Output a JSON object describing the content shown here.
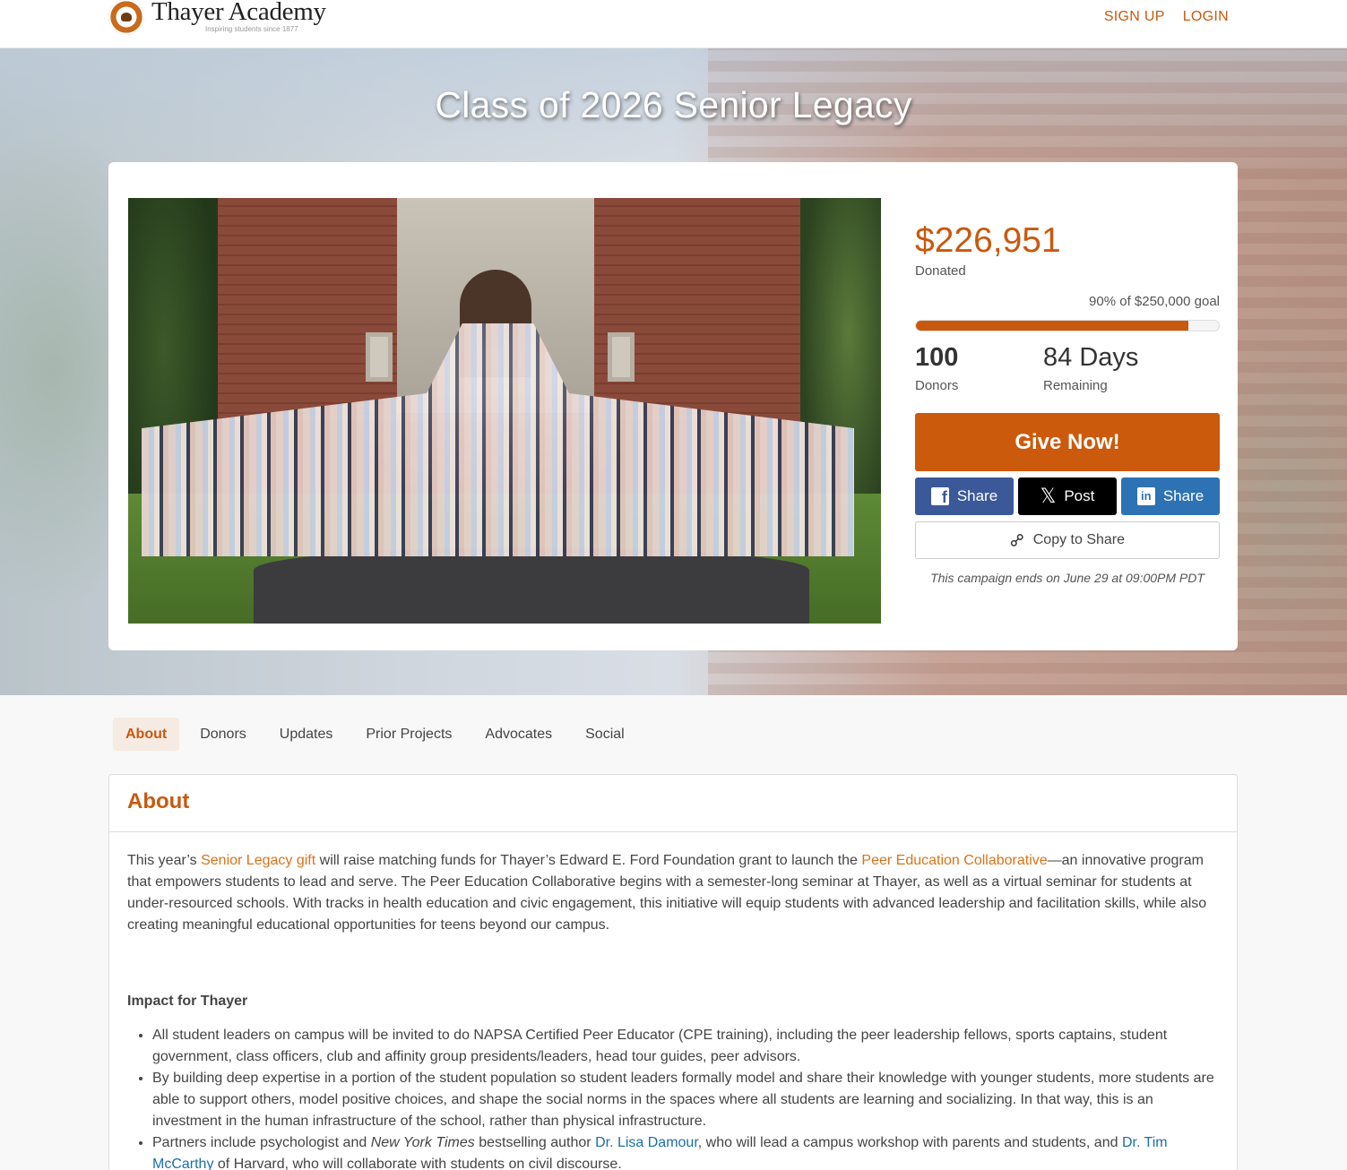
{
  "header": {
    "logo_name": "Thayer Academy",
    "logo_tagline": "Inspiring students since 1877",
    "signup": "SIGN UP",
    "login": "LOGIN"
  },
  "hero": {
    "title": "Class of 2026 Senior Legacy"
  },
  "campaign": {
    "amount": "$226,951",
    "amount_label": "Donated",
    "goal_text": "90% of $250,000 goal",
    "progress_fraction": 0.9,
    "donors_value": "100",
    "donors_label": "Donors",
    "days_value": "84 Days",
    "days_label": "Remaining",
    "give_label": "Give Now!",
    "share_facebook": "Share",
    "share_x": "Post",
    "share_linkedin": "Share",
    "copy_label": "Copy to Share",
    "ends_text": "This campaign ends on June 29 at 09:00PM PDT"
  },
  "tabs": [
    "About",
    "Donors",
    "Updates",
    "Prior Projects",
    "Advocates",
    "Social"
  ],
  "about": {
    "title": "About",
    "p1_a": "This year’s ",
    "p1_link1": "Senior Legacy gift",
    "p1_b": " will raise matching funds for Thayer’s Edward E. Ford Foundation grant to launch the ",
    "p1_link2": "Peer Education Collaborative",
    "p1_c": "—an innovative program that empowers students to lead and serve. The Peer Education Collaborative begins with a semester-long seminar at Thayer, as well as a virtual seminar for students at under-resourced schools. With tracks in health education and civic engagement, this initiative will equip students with advanced leadership and facilitation skills, while also creating meaningful educational opportunities for teens beyond our campus.",
    "impact_heading": "Impact for Thayer",
    "bullet1": "All student leaders on campus will be invited to do NAPSA Certified Peer Educator (CPE training), including the peer leadership fellows, sports captains, student government, class officers, club and affinity group presidents/leaders, head tour guides, peer advisors.",
    "bullet2": "By building deep expertise in a portion of the student population so student leaders formally model and share their knowledge with younger students, more students are able to support others, model positive choices, and shape the social norms in the spaces where all students are learning and socializing. In that way, this is an investment in the human infrastructure of the school, rather than physical infrastructure.",
    "bullet3_a": "Partners include psychologist and ",
    "bullet3_em": "New York Times",
    "bullet3_b": " bestselling author ",
    "bullet3_link1": "Dr. Lisa Damour",
    "bullet3_c": ", who will lead a campus workshop with parents and students, and ",
    "bullet3_link2": "Dr. Tim McCarthy",
    "bullet3_d": " of Harvard, who will collaborate with students on civil discourse."
  },
  "colors": {
    "accent": "#c8590f",
    "facebook": "#3b5898",
    "x": "#000000",
    "linkedin": "#2d72b3",
    "link_blue": "#1d6fa5"
  }
}
